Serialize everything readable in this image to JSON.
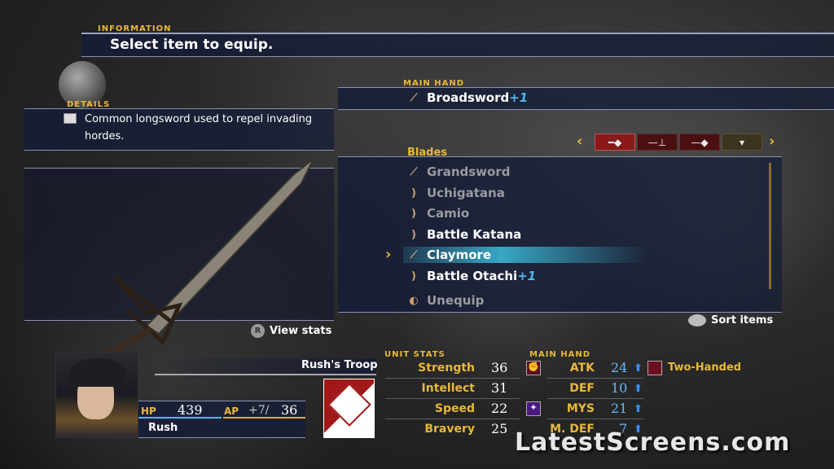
{
  "information": {
    "label": "Information",
    "text": "Select item to equip."
  },
  "details": {
    "label": "Details",
    "icon": "book-icon",
    "text": "Common longsword used to repel invading hordes."
  },
  "main_hand": {
    "label": "Main hand",
    "item": "Broadsword",
    "bonus": "+1"
  },
  "category_tabs": [
    {
      "icon": "sword-icon",
      "active": true
    },
    {
      "icon": "axe-icon",
      "active": false
    },
    {
      "icon": "mace-icon",
      "active": false
    },
    {
      "icon": "shield-icon",
      "active": false
    }
  ],
  "list": {
    "category": "Blades",
    "items": [
      {
        "name": "Grandsword",
        "bonus": "",
        "available": false
      },
      {
        "name": "Uchigatana",
        "bonus": "",
        "available": false
      },
      {
        "name": "Camio",
        "bonus": "",
        "available": false
      },
      {
        "name": "Battle Katana",
        "bonus": "",
        "available": true
      },
      {
        "name": "Claymore",
        "bonus": "",
        "available": true,
        "selected": true
      },
      {
        "name": "Battle Otachi",
        "bonus": "+1",
        "available": true
      }
    ],
    "unequip": "Unequip"
  },
  "buttons": {
    "view_stats_key": "R",
    "view_stats": "View stats",
    "sort_items": "Sort items"
  },
  "unit": {
    "troop": "Rush's Troop",
    "name": "Rush",
    "hp_label": "HP",
    "hp": "439",
    "ap_label": "AP",
    "ap_bonus": "+7/",
    "ap": "36"
  },
  "unit_stats": {
    "label": "Unit stats",
    "rows": [
      {
        "name": "Strength",
        "value": "36"
      },
      {
        "name": "Intellect",
        "value": "31"
      },
      {
        "name": "Speed",
        "value": "22"
      },
      {
        "name": "Bravery",
        "value": "25"
      }
    ]
  },
  "weapon_stats": {
    "label": "Main hand",
    "rows": [
      {
        "name": "ATK",
        "value": "24",
        "trend": "up"
      },
      {
        "name": "DEF",
        "value": "10",
        "trend": "up"
      },
      {
        "name": "MYS",
        "value": "21",
        "trend": "up"
      },
      {
        "name": "M. DEF",
        "value": "7",
        "trend": "up"
      }
    ],
    "trait": "Two-Handed"
  },
  "watermark": "LatestScreens.com",
  "colors": {
    "gold": "#e8b83a",
    "plus": "#4fb8e8",
    "selection": "#3ec8e8",
    "panel": "#141c37"
  }
}
